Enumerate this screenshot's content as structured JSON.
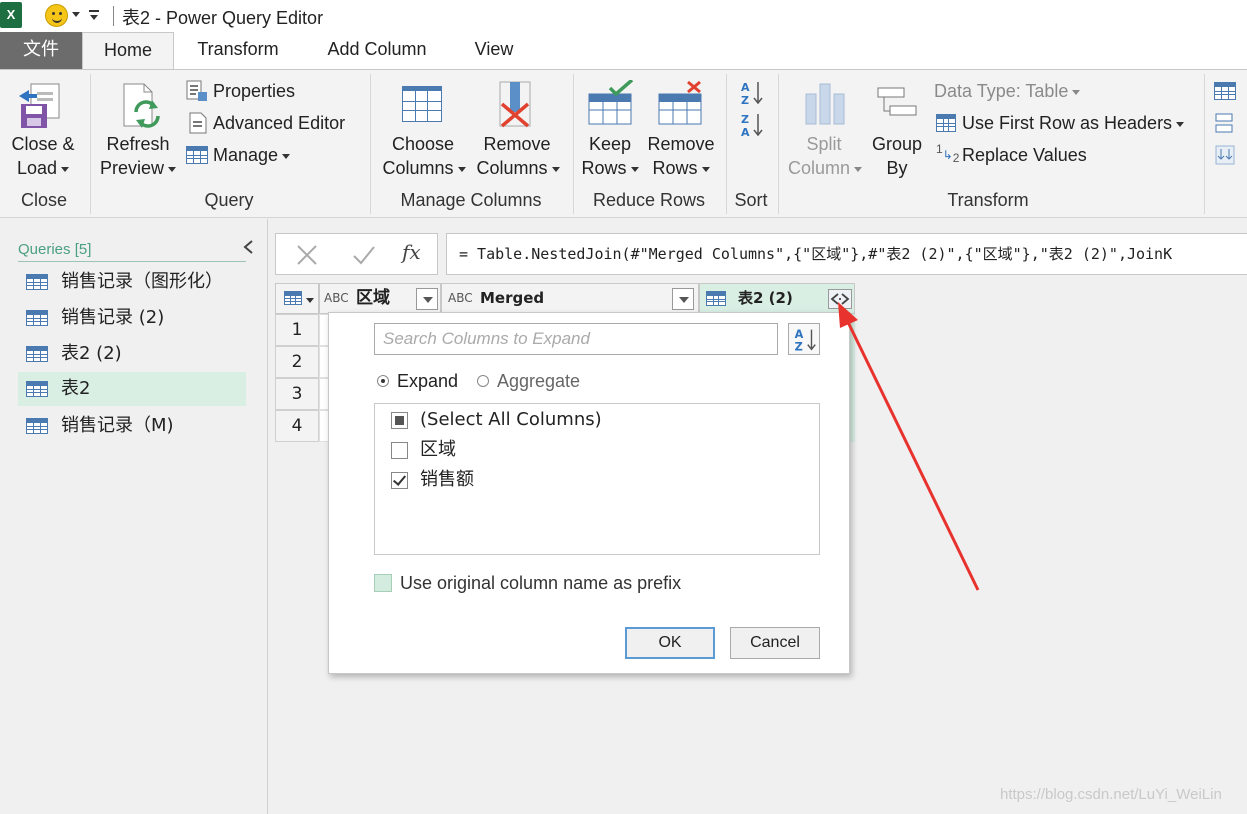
{
  "title_bar": {
    "app_icon": "X",
    "window_title": "表2 - Power Query Editor"
  },
  "tabs": [
    {
      "label": "文件"
    },
    {
      "label": "Home"
    },
    {
      "label": "Transform"
    },
    {
      "label": "Add Column"
    },
    {
      "label": "View"
    }
  ],
  "ribbon": {
    "close": {
      "btn_line1": "Close &",
      "btn_line2": "Load",
      "group": "Close"
    },
    "query": {
      "refresh_line1": "Refresh",
      "refresh_line2": "Preview",
      "properties": "Properties",
      "advanced_editor": "Advanced Editor",
      "manage": "Manage",
      "group": "Query"
    },
    "manage_columns": {
      "choose_line1": "Choose",
      "choose_line2": "Columns",
      "remove_line1": "Remove",
      "remove_line2": "Columns",
      "group": "Manage Columns"
    },
    "reduce_rows": {
      "keep_line1": "Keep",
      "keep_line2": "Rows",
      "remove_line1": "Remove",
      "remove_line2": "Rows",
      "group": "Reduce Rows"
    },
    "sort": {
      "group": "Sort"
    },
    "transform": {
      "split_line1": "Split",
      "split_line2": "Column",
      "group_line1": "Group",
      "group_line2": "By",
      "data_type": "Data Type: Table",
      "first_row_headers": "Use First Row as Headers",
      "replace_values": "Replace Values",
      "replace_prefix": "1",
      "replace_sub": "2",
      "group": "Transform"
    }
  },
  "queries": {
    "header": "Queries [5]",
    "items": [
      {
        "label": "销售记录（图形化）"
      },
      {
        "label": "销售记录 (2)"
      },
      {
        "label": "表2 (2)"
      },
      {
        "label": "表2"
      },
      {
        "label": "销售记录（M)"
      }
    ]
  },
  "formula_bar": {
    "fx": "fx",
    "formula": "= Table.NestedJoin(#\"Merged Columns\",{\"区域\"},#\"表2 (2)\",{\"区域\"},\"表2 (2)\",JoinK"
  },
  "grid": {
    "columns": [
      {
        "type_icon": "ABC",
        "name": "区域"
      },
      {
        "type_icon": "ABC",
        "name": "Merged"
      },
      {
        "name": "表2 (2)"
      }
    ],
    "row_numbers": [
      "1",
      "2",
      "3",
      "4"
    ]
  },
  "expand_popup": {
    "search_placeholder": "Search Columns to Expand",
    "radio_expand": "Expand",
    "radio_aggregate": "Aggregate",
    "items": [
      {
        "label": "(Select All Columns)",
        "state": "partial"
      },
      {
        "label": "区域",
        "state": "unchecked"
      },
      {
        "label": "销售额",
        "state": "checked"
      }
    ],
    "prefix_label": "Use original column name as prefix",
    "ok": "OK",
    "cancel": "Cancel"
  },
  "watermark": "https://blog.csdn.net/LuYi_WeiLin",
  "colors": {
    "accent_green": "#4aa080",
    "annotation_red": "#e8322e",
    "file_tab": "#6c6c6c"
  }
}
